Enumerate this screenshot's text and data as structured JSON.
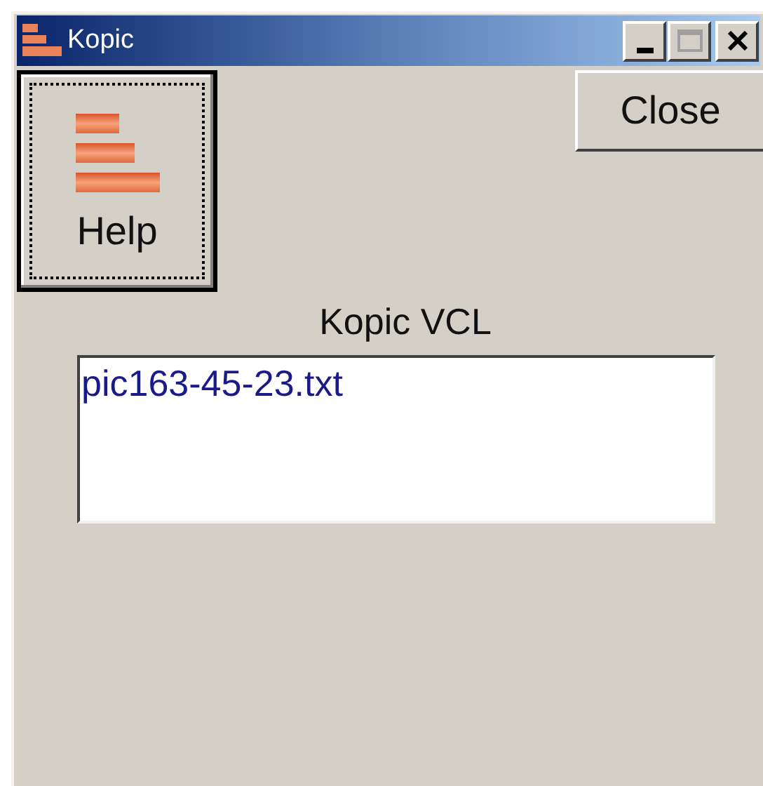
{
  "window": {
    "title": "Kopic"
  },
  "buttons": [
    {
      "label": "Help",
      "kind": "image",
      "focused": true
    },
    {
      "label": "Close",
      "kind": "text",
      "focused": false
    }
  ],
  "label": "Kopic VCL",
  "memo": {
    "value": "pic163-45-23.txt"
  }
}
